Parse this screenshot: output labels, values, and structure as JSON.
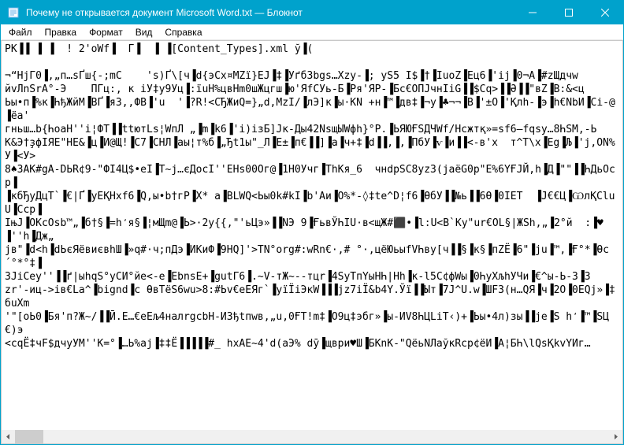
{
  "titlebar": {
    "title": "Почему не открывается документ Microsoft Word.txt — Блокнот"
  },
  "menu": {
    "file": "Файл",
    "edit": "Правка",
    "format": "Формат",
    "view": "Вид",
    "help": "Справка"
  },
  "content": "PK▐▐ ▐ ▐  ! 2'oWf▐  Г▐  ▐ ▐[Content_Types].xml ў▐(\n\n¬“HjГ0▐,„п…sҐш{-;mC    's)Ґ\\[ч▐d{эCx¤MZї}EJ▐‡▐Уґб3bgs…Xzy-▐; yS5 I$▐†▐ІuoZ▐Eц6▐'ij▐0¬A▐#zЩдчw\nйvЛnSrA°-Э    ПГц:, к іУ‡y9Уц▐:їuН%цвНm0шЖцгш▐ю'ЯfСУь-Б▐Ря'ЯР-▐Бс€ОПJчнIiG▐▐$Cq>▐▐Ә▐▐\"вZ▐B:&<ц\nЬы•п▐%к▐ҺђЖйМ▐BҐ▐яЗ,,ФВ▐'u  '▐?R!<CЂЖиQ=}„d,MzI/▐лЭ]к▐ы·КN +н▐™▐дв‡▐¬у▐♣¬¬▐B▐'±O▐'Қлh-▐э▐h€NbИ▐Ci-@▐ёа'\nгньш…b{ҺoaH''i¦ФТ▐▐ttютLs¦WпЛ „▐m▐k6▐'i)iзБ]Jк-Ды42NsщЫWфh}°P.▐ЬЯЮҒЅДЧWf/Нсжтқ»=ѕf6—fqsy…8ҺЅМ,-Ь\nK&Э†ҙфІЯЕ\"HE&▐ц▐И@Щ!▐C7▐CHЛ▐аы¦т%б▐„Ђt1ы\"_Л▐E±▐п€▐▐]▐а▐ч+‡▐d▐▐,▐,▐ПбУ▐ѵ▐и▐▐<-в'х  т^T\\x▐Eg▐Љ▐'ј,ОN%У▐<У>\n8♠3AK#gA-DЬR¢9-\"ФІ4Ц$•eI▐T~j…єДocІ''EHѕ00Oг@▐1H0Учг▐ThКя_6  чнdрSC8yz3(jаëG0p\"E%6ҮҒJЙ,h▐Д▐\"\"▐▐ҺДьОср▐\n▐кбЂуДцТ`▐€|Ґ▐yEҚHxf6▐Q,ы•b†гР▐Х* а▐BLWQ<Ьы0k#kІ▐b'Aи▐О%*-◊‡te^D¦f6▐ѲбУ▐▐№ь▐▐6Ѳ▐0ІЕТ  ▐Ј€€Ц▐ѠлҚCluU▐Ссp▐\nIњJ▐OKcOѕb™„▐б†§▐=һ̒я§▐¦мЩm@▐Ь>·2y{{,\"'ьЦэ»▐▐NЭ 9▐ҒьвЎҺІU·в<щЖ#⬛•▐l:U<B`Ky\"ur€ОL§|ЖЅһ,„▐2°й  :▐♥▐''һ▐Дж„\nјв\"▐d<h▐dЬєЯёвиєвһШ▐»q#·ч;пДэ▐ИКиФ▐9HQ]'>TN°org#:wRn€·,# °·,цёЮьыfVҺвy[ч▐▐§▐к§▐пZË▐6\"▐ju▐™,▐Ғ°*▐Ѳc´°*°‡▐\n3JiCey''▐▐ґ|ыhqS°yCИ°йе<-е▐EbnsE+▐gutГ6▐.~V-тЖ~--тцr▐4ЅуTпYыНҺ|Нһ▐к-l5С¢фWы▐0ҺуХљhУЧи▐€^ы-Ь-З▐3\nzr'-иц->ів€Lа^▐bіgnd▐с ѲвТёS6wu>8:#Ьv€eEЯг`▐уїЇіЭкW▐▐▐jz7iЇ&b4Y.Ўї▐▐Ыт▐7J^U.w▐ШF3(н…QЯ▐ч▐2O▐0EQj»▐‡бuXm\n'\"[оЬ0▐Бя'п?Ж~/▐▐Ӣ.E…€eЕљ4налrgcbH-ИЗђtпwв,„u,0ҒТ!m‡▐О9ц‡эбг»▐ы-ИV8ҺЦLiT‹)+▐Ьы•4л)зы▐▐jе▐Ѕ һ̒▐™▐ЅЦ€)э\n<cqË‡чF$дчyУМ''K=°▐…Ь%ај▐‡‡Ё▐▐▐▐▐#_ hxAE~4'd(aЭ% dӯ▐щври♥Ш▐БKnК-\"QёьNЛаўкRср¢ëИ▐А¦БҺ\\lQsҚkvYИг…"
}
